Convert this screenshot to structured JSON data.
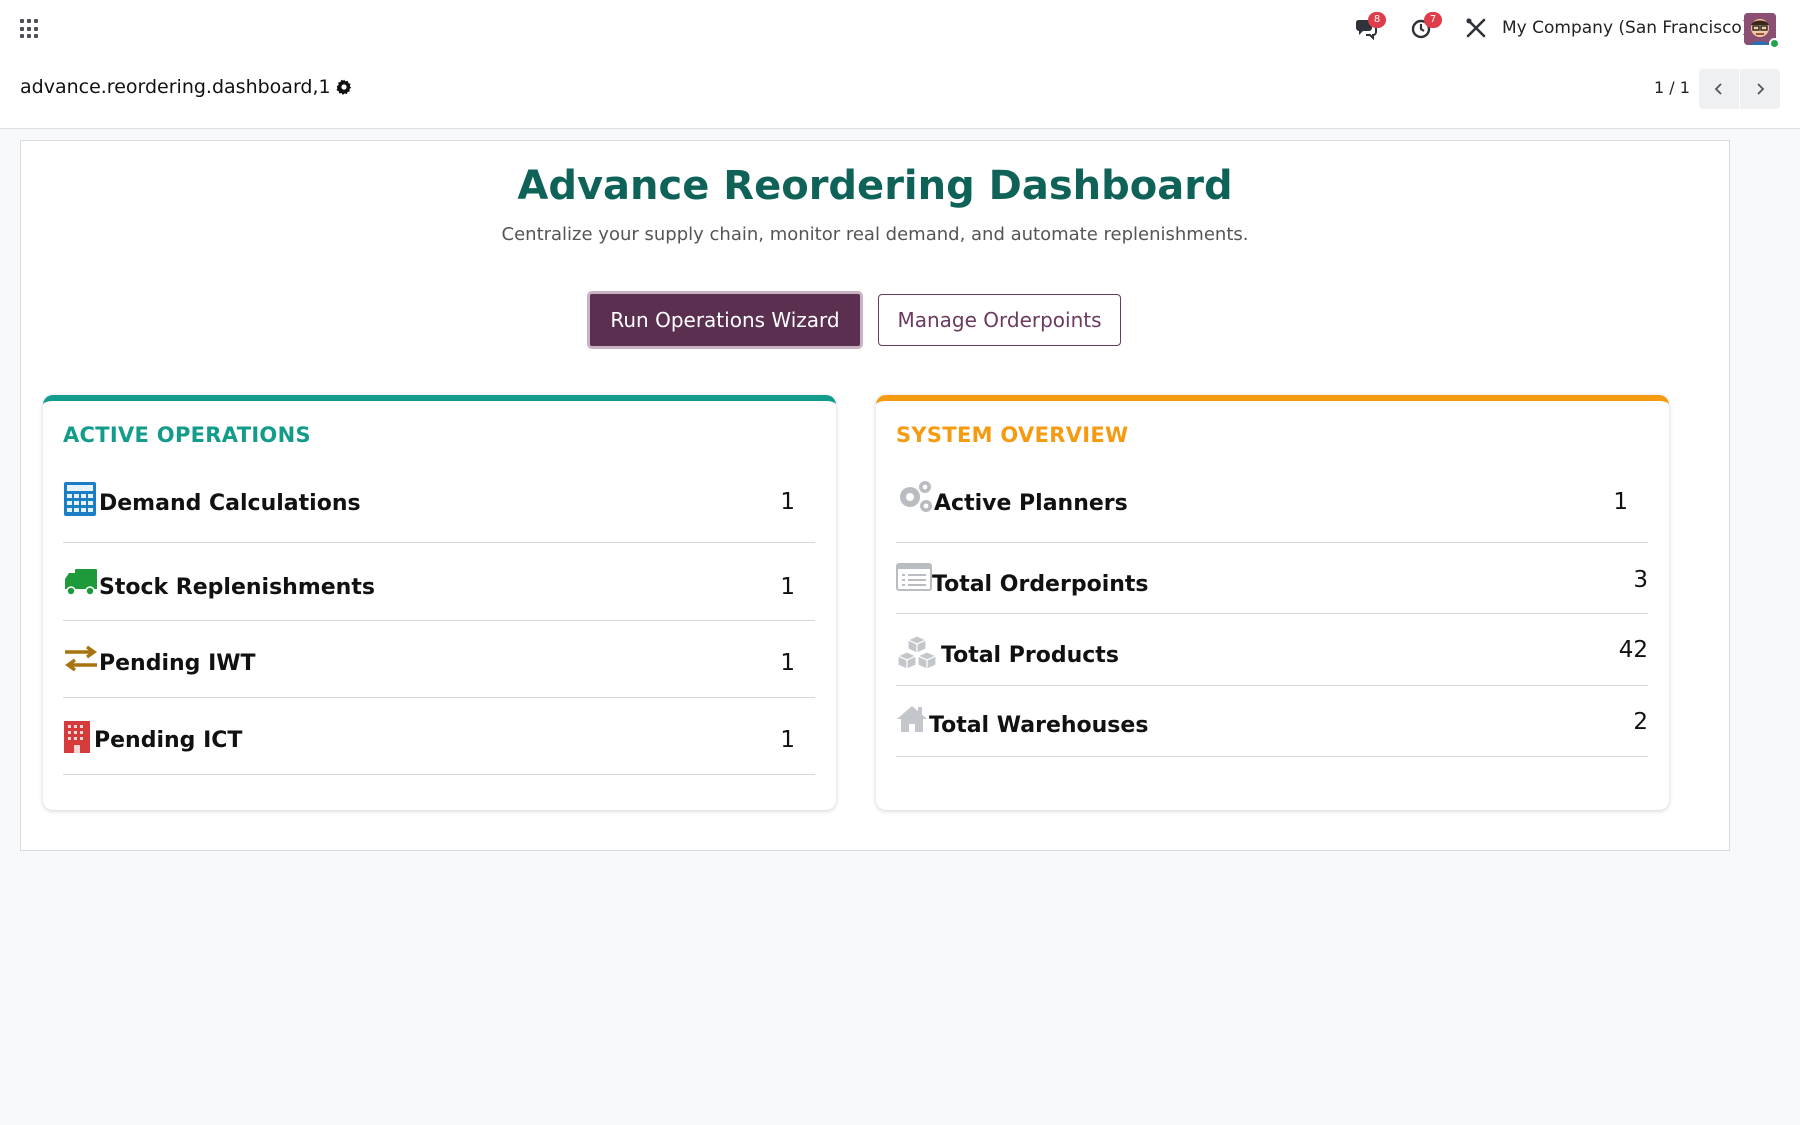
{
  "navbar": {
    "apps_icon": "grid-menu-icon",
    "messages_badge": "8",
    "activities_badge": "7",
    "company": "My Company (San Francisco)"
  },
  "control": {
    "record_name": "advance.reordering.dashboard,1",
    "pager": "1 / 1"
  },
  "dashboard": {
    "title": "Advance Reordering Dashboard",
    "subtitle": "Centralize your supply chain, monitor real demand, and automate replenishments.",
    "primary_button": "Run Operations Wizard",
    "secondary_button": "Manage Orderpoints"
  },
  "active_operations": {
    "title": "ACTIVE OPERATIONS",
    "accent": "#139c8b",
    "rows": [
      {
        "label": "Demand Calculations",
        "value": "1",
        "icon": "calculator-icon"
      },
      {
        "label": "Stock Replenishments",
        "value": "1",
        "icon": "truck-icon"
      },
      {
        "label": "Pending IWT",
        "value": "1",
        "icon": "exchange-arrows-icon"
      },
      {
        "label": "Pending ICT",
        "value": "1",
        "icon": "building-icon"
      }
    ]
  },
  "system_overview": {
    "title": "SYSTEM OVERVIEW",
    "accent": "#f59b12",
    "rows": [
      {
        "label": "Active Planners",
        "value": "1",
        "icon": "gears-icon"
      },
      {
        "label": "Total Orderpoints",
        "value": "3",
        "icon": "list-icon"
      },
      {
        "label": "Total Products",
        "value": "42",
        "icon": "cubes-icon"
      },
      {
        "label": "Total Warehouses",
        "value": "2",
        "icon": "home-icon"
      }
    ]
  }
}
